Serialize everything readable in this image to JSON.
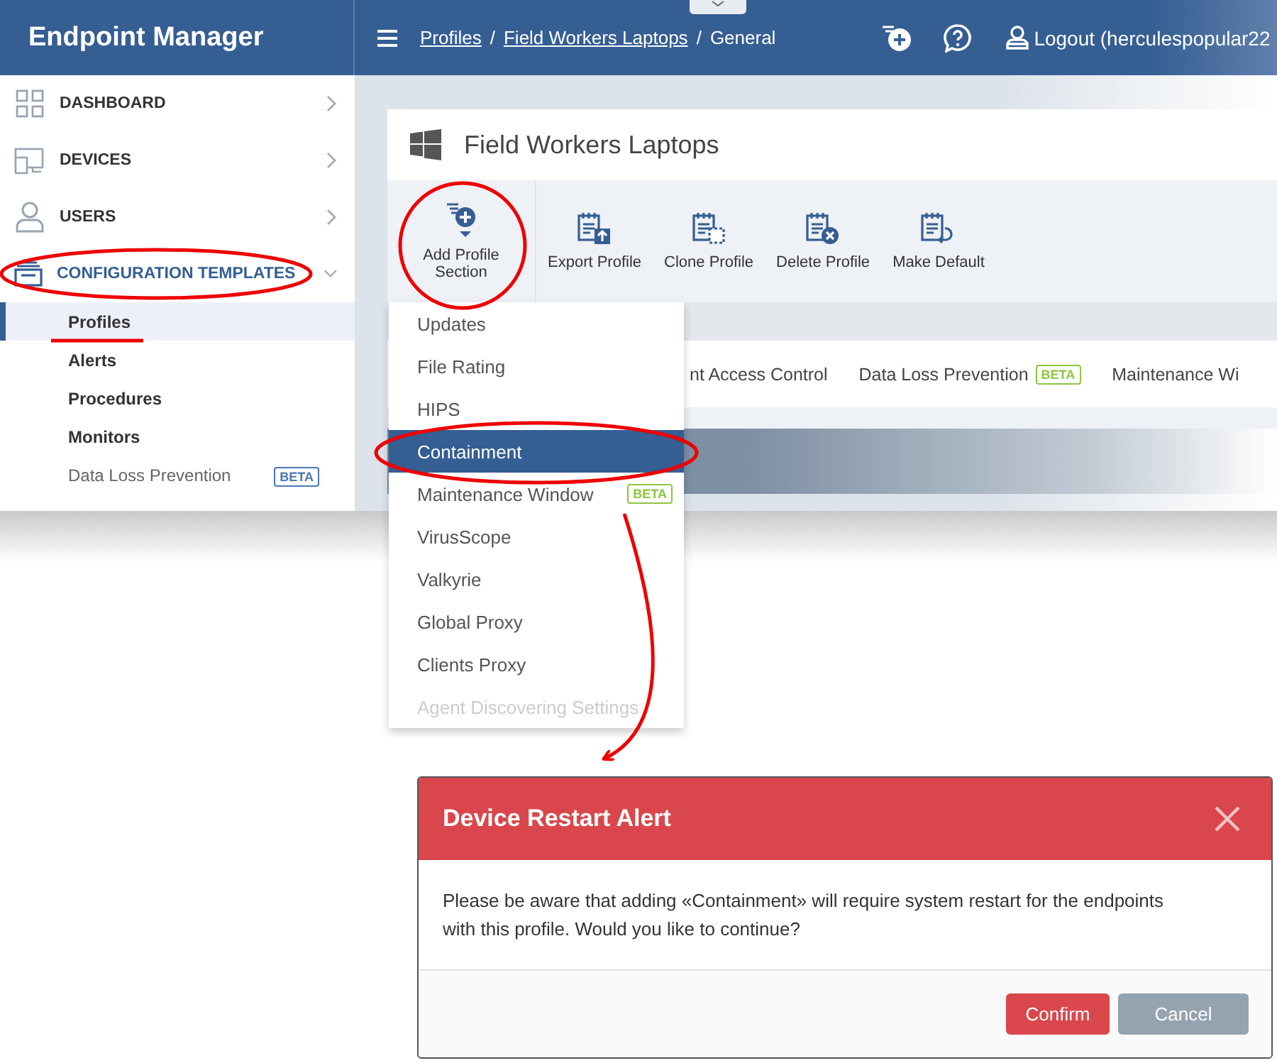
{
  "app_title": "Endpoint Manager",
  "header": {
    "breadcrumbs": [
      {
        "label": "Profiles",
        "link": true,
        "separator": "/"
      },
      {
        "label": "Field Workers Laptops",
        "link": true,
        "separator": "/"
      },
      {
        "label": "General",
        "link": false
      }
    ],
    "user": "Logout (herculespopular22"
  },
  "sidebar": {
    "items": [
      {
        "label": "DASHBOARD",
        "expanded": false
      },
      {
        "label": "DEVICES",
        "expanded": false
      },
      {
        "label": "USERS",
        "expanded": false
      },
      {
        "label": "CONFIGURATION TEMPLATES",
        "expanded": true,
        "children": [
          {
            "label": "Profiles",
            "selected": true
          },
          {
            "label": "Alerts",
            "selected": false
          },
          {
            "label": "Procedures",
            "selected": false
          },
          {
            "label": "Monitors",
            "selected": false
          },
          {
            "label": "Data Loss Prevention",
            "selected": false,
            "badge": "BETA"
          }
        ]
      }
    ]
  },
  "profile": {
    "title": "Field Workers Laptops",
    "toolbar": [
      {
        "label": "Add Profile Section"
      },
      {
        "label": "Export Profile"
      },
      {
        "label": "Clone Profile"
      },
      {
        "label": "Delete Profile"
      },
      {
        "label": "Make Default"
      }
    ],
    "tabs": [
      {
        "label": "nt Access Control"
      },
      {
        "label": "Data Loss Prevention",
        "badge": "BETA"
      },
      {
        "label": "Maintenance Wi"
      }
    ]
  },
  "section_menu": {
    "items": [
      {
        "label": "Updates",
        "selected": false,
        "disabled": false
      },
      {
        "label": "File Rating",
        "selected": false,
        "disabled": false
      },
      {
        "label": "HIPS",
        "selected": false,
        "disabled": false
      },
      {
        "label": "Containment",
        "selected": true,
        "disabled": false
      },
      {
        "label": "Maintenance Window",
        "selected": false,
        "disabled": false,
        "badge": "BETA"
      },
      {
        "label": "VirusScope",
        "selected": false,
        "disabled": false
      },
      {
        "label": "Valkyrie",
        "selected": false,
        "disabled": false
      },
      {
        "label": "Global Proxy",
        "selected": false,
        "disabled": false
      },
      {
        "label": "Clients Proxy",
        "selected": false,
        "disabled": false
      },
      {
        "label": "Agent Discovering Settings",
        "selected": false,
        "disabled": true
      }
    ]
  },
  "dialog": {
    "title": "Device Restart Alert",
    "message": "Please be aware that adding «Containment» will require system restart for the endpoints with this profile. Would you like to continue?",
    "buttons": [
      {
        "label": "Confirm",
        "kind": "primary"
      },
      {
        "label": "Cancel",
        "kind": "secondary"
      }
    ]
  }
}
